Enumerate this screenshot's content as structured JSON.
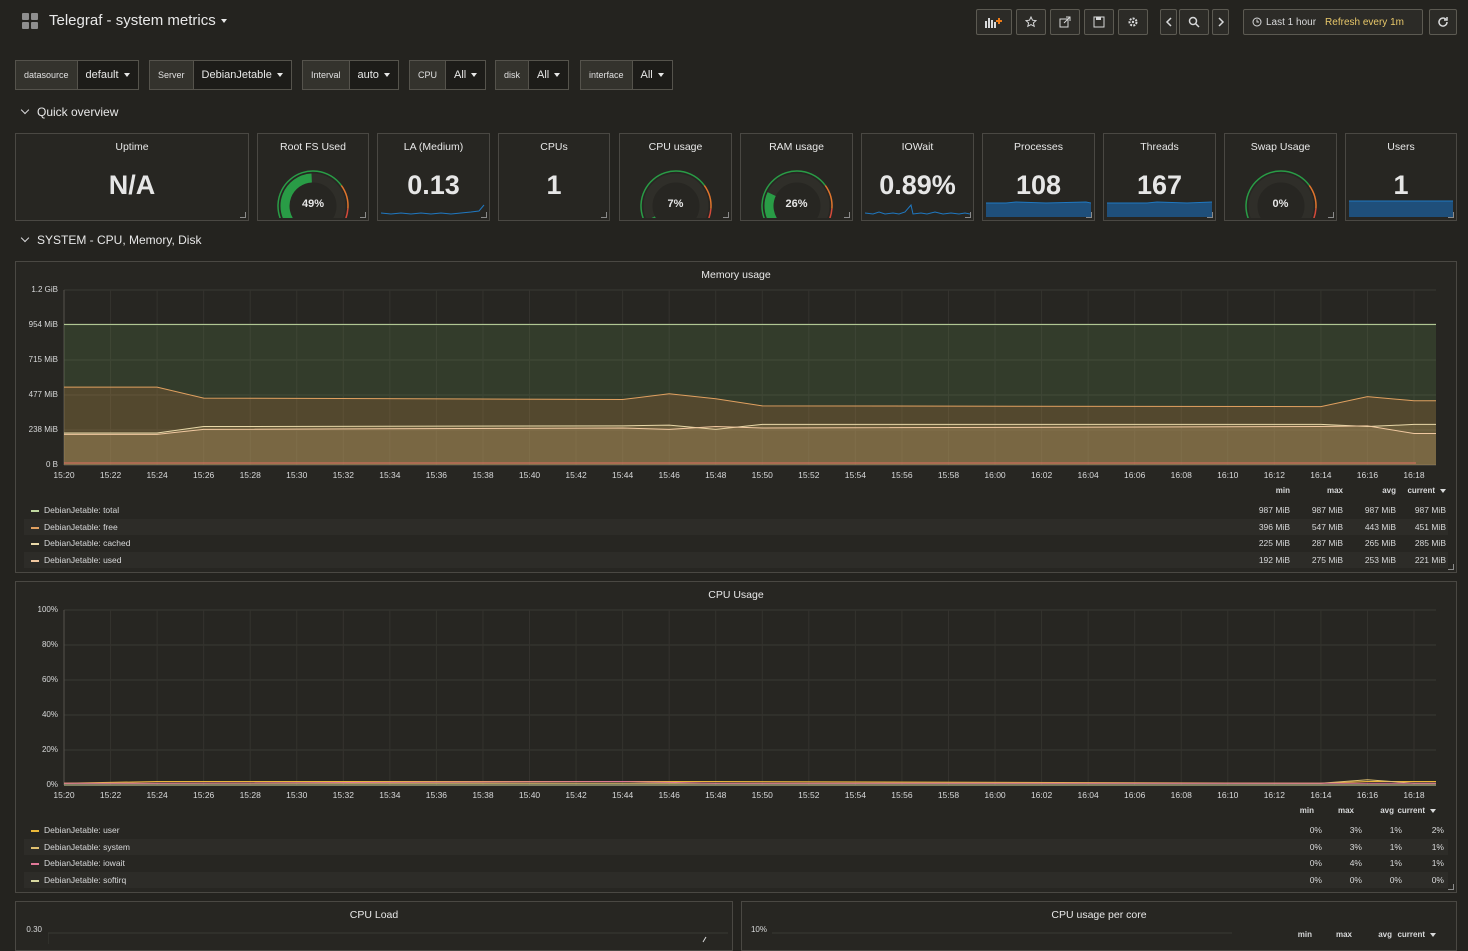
{
  "header": {
    "title": "Telegraf - system metrics",
    "time_range": "Last 1 hour",
    "refresh": "Refresh every 1m"
  },
  "variables": [
    {
      "label": "datasource",
      "value": "default"
    },
    {
      "label": "Server",
      "value": "DebianJetable"
    },
    {
      "label": "Interval",
      "value": "auto"
    },
    {
      "label": "CPU",
      "value": "All"
    },
    {
      "label": "disk",
      "value": "All"
    },
    {
      "label": "interface",
      "value": "All"
    }
  ],
  "rows": {
    "quick": "Quick overview",
    "system": "SYSTEM - CPU, Memory, Disk"
  },
  "stats": [
    {
      "title": "Uptime",
      "value": "N/A"
    },
    {
      "title": "Root FS Used",
      "value": "49%",
      "gauge": 0.49
    },
    {
      "title": "LA (Medium)",
      "value": "0.13"
    },
    {
      "title": "CPUs",
      "value": "1"
    },
    {
      "title": "CPU usage",
      "value": "7%",
      "gauge": 0.07
    },
    {
      "title": "RAM usage",
      "value": "26%",
      "gauge": 0.26
    },
    {
      "title": "IOWait",
      "value": "0.89%"
    },
    {
      "title": "Processes",
      "value": "108"
    },
    {
      "title": "Threads",
      "value": "167"
    },
    {
      "title": "Swap Usage",
      "value": "0%",
      "gauge": 0.0
    },
    {
      "title": "Users",
      "value": "1"
    }
  ],
  "colors": {
    "green": "#299c46",
    "orange": "#e0752d",
    "yellow": "#eab839",
    "blue": "#1f78c1",
    "bg": "#24231f"
  },
  "memory": {
    "title": "Memory usage",
    "yticks": [
      "1.2 GiB",
      "954 MiB",
      "715 MiB",
      "477 MiB",
      "238 MiB",
      "0 B"
    ],
    "legend_head": [
      "min",
      "max",
      "avg",
      "current"
    ],
    "legend": [
      {
        "name": "DebianJetable: total",
        "color": "#c0d8a0",
        "min": "987 MiB",
        "max": "987 MiB",
        "avg": "987 MiB",
        "current": "987 MiB"
      },
      {
        "name": "DebianJetable: free",
        "color": "#e0a060",
        "min": "396 MiB",
        "max": "547 MiB",
        "avg": "443 MiB",
        "current": "451 MiB"
      },
      {
        "name": "DebianJetable: cached",
        "color": "#e8d8a8",
        "min": "225 MiB",
        "max": "287 MiB",
        "avg": "265 MiB",
        "current": "285 MiB"
      },
      {
        "name": "DebianJetable: used",
        "color": "#f0c8a0",
        "min": "192 MiB",
        "max": "275 MiB",
        "avg": "253 MiB",
        "current": "221 MiB"
      }
    ]
  },
  "cpu": {
    "title": "CPU Usage",
    "yticks": [
      "100%",
      "80%",
      "60%",
      "40%",
      "20%",
      "0%"
    ],
    "legend_head": [
      "min",
      "max",
      "avg",
      "current"
    ],
    "legend": [
      {
        "name": "DebianJetable: user",
        "color": "#eab839",
        "min": "0%",
        "max": "3%",
        "avg": "1%",
        "current": "2%"
      },
      {
        "name": "DebianJetable: system",
        "color": "#e0c070",
        "min": "0%",
        "max": "3%",
        "avg": "1%",
        "current": "1%"
      },
      {
        "name": "DebianJetable: iowait",
        "color": "#e07898",
        "min": "0%",
        "max": "4%",
        "avg": "1%",
        "current": "1%"
      },
      {
        "name": "DebianJetable: softirq",
        "color": "#d8d8a0",
        "min": "0%",
        "max": "0%",
        "avg": "0%",
        "current": "0%"
      }
    ]
  },
  "xticks": [
    "15:20",
    "15:22",
    "15:24",
    "15:26",
    "15:28",
    "15:30",
    "15:32",
    "15:34",
    "15:36",
    "15:38",
    "15:40",
    "15:42",
    "15:44",
    "15:46",
    "15:48",
    "15:50",
    "15:52",
    "15:54",
    "15:56",
    "15:58",
    "16:00",
    "16:02",
    "16:04",
    "16:06",
    "16:08",
    "16:10",
    "16:12",
    "16:14",
    "16:16",
    "16:18"
  ],
  "bottom": {
    "cpu_load_title": "CPU Load",
    "cpu_load_ytop": "0.30",
    "per_core_title": "CPU usage per core",
    "per_core_ytop": "10%",
    "per_core_head": [
      "min",
      "max",
      "avg",
      "current"
    ]
  },
  "chart_data": [
    {
      "type": "area",
      "title": "Memory usage",
      "x": [
        "15:20",
        "15:24",
        "15:26",
        "15:44",
        "15:46",
        "15:48",
        "15:50",
        "16:14",
        "16:16",
        "16:18"
      ],
      "series": [
        {
          "name": "DebianJetable: total",
          "values": [
            987,
            987,
            987,
            987,
            987,
            987,
            987,
            987,
            987,
            987
          ]
        },
        {
          "name": "DebianJetable: free",
          "values": [
            547,
            547,
            470,
            460,
            500,
            465,
            415,
            410,
            480,
            451
          ]
        },
        {
          "name": "DebianJetable: cached",
          "values": [
            225,
            225,
            270,
            275,
            280,
            250,
            285,
            285,
            270,
            285
          ]
        },
        {
          "name": "DebianJetable: used",
          "values": [
            215,
            215,
            250,
            260,
            250,
            270,
            260,
            270,
            275,
            221
          ]
        }
      ]
    },
    {
      "type": "line",
      "title": "CPU Usage",
      "x": [
        "15:20",
        "15:24",
        "15:44",
        "15:48",
        "16:14",
        "16:16",
        "16:18"
      ],
      "series": [
        {
          "name": "DebianJetable: user",
          "values": [
            1,
            2,
            2,
            2,
            1,
            2,
            2
          ]
        },
        {
          "name": "DebianJetable: system",
          "values": [
            1,
            1,
            1,
            1,
            1,
            3,
            1
          ]
        },
        {
          "name": "DebianJetable: iowait",
          "values": [
            1,
            1,
            2,
            1,
            1,
            1,
            1
          ]
        },
        {
          "name": "DebianJetable: softirq",
          "values": [
            0,
            0,
            0,
            0,
            0,
            0,
            0
          ]
        }
      ]
    }
  ]
}
